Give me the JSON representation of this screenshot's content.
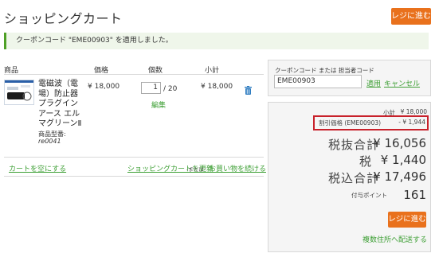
{
  "page": {
    "title": "ショッピングカート",
    "checkout_button": "レジに進む"
  },
  "notice": {
    "text": "クーポンコード \"EME00903\" を適用しました。"
  },
  "table": {
    "headers": {
      "product": "商品",
      "price": "価格",
      "quantity": "個数",
      "subtotal": "小計"
    }
  },
  "item": {
    "name_lines": [
      "電磁波（電",
      "場）防止器",
      "プラグイン",
      "アース エル",
      "マグリーンⅡ"
    ],
    "model_label": "商品型番:",
    "model": "re0041",
    "price": "¥ 18,000",
    "quantity": "1",
    "quantity_max": "/ 20",
    "edit": "編集",
    "subtotal": "¥ 18,000"
  },
  "cart_actions": {
    "clear": "カートを空にする",
    "update": "ショッピングカートを更新",
    "or": "-または-",
    "continue": "お買い物を続ける"
  },
  "coupon": {
    "label": "クーポンコード または 担当者コード",
    "value": "EME00903",
    "apply": "適用",
    "cancel": "キャンセル"
  },
  "summary": {
    "subtotal_label": "小計",
    "subtotal": "¥ 18,000",
    "discount_label": "割引価格 (EME00903)",
    "discount": "- ¥ 1,944",
    "pre_tax_label": "税抜合計",
    "pre_tax": "¥ 16,056",
    "tax_label": "税",
    "tax": "¥ 1,440",
    "total_label": "税込合計",
    "total": "¥ 17,496",
    "points_label": "付与ポイント",
    "points": "161",
    "checkout": "レジに進む",
    "multi_ship": "複数住所へ配送する"
  },
  "colors": {
    "accent": "#e9711c",
    "link": "#3d9f34",
    "notice_bar": "#4ea026",
    "highlight": "#c8212b"
  }
}
